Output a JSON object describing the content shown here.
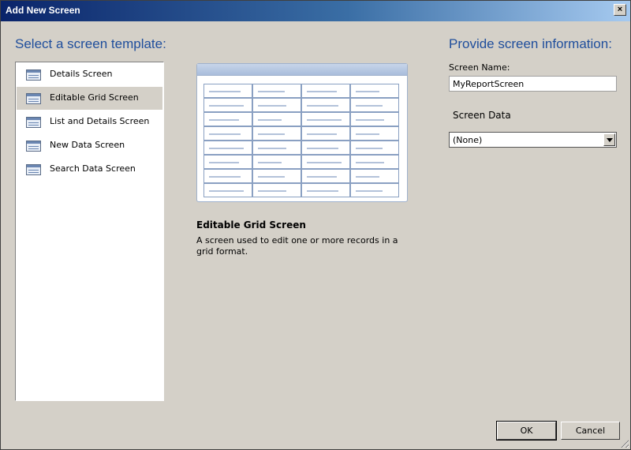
{
  "window": {
    "title": "Add New Screen",
    "close_glyph": "×"
  },
  "left": {
    "heading": "Select a screen template:",
    "templates": [
      {
        "label": "Details Screen",
        "selected": false
      },
      {
        "label": "Editable Grid Screen",
        "selected": true
      },
      {
        "label": "List and Details Screen",
        "selected": false
      },
      {
        "label": "New Data Screen",
        "selected": false
      },
      {
        "label": "Search Data Screen",
        "selected": false
      }
    ]
  },
  "preview": {
    "title": "Editable Grid Screen",
    "description": "A screen used to edit one or more records in a grid format."
  },
  "right": {
    "heading": "Provide screen information:",
    "screen_name_label": "Screen Name:",
    "screen_name_value": "MyReportScreen",
    "screen_data_label": "Screen Data",
    "screen_data_value": "(None)"
  },
  "buttons": {
    "ok": "OK",
    "cancel": "Cancel"
  }
}
